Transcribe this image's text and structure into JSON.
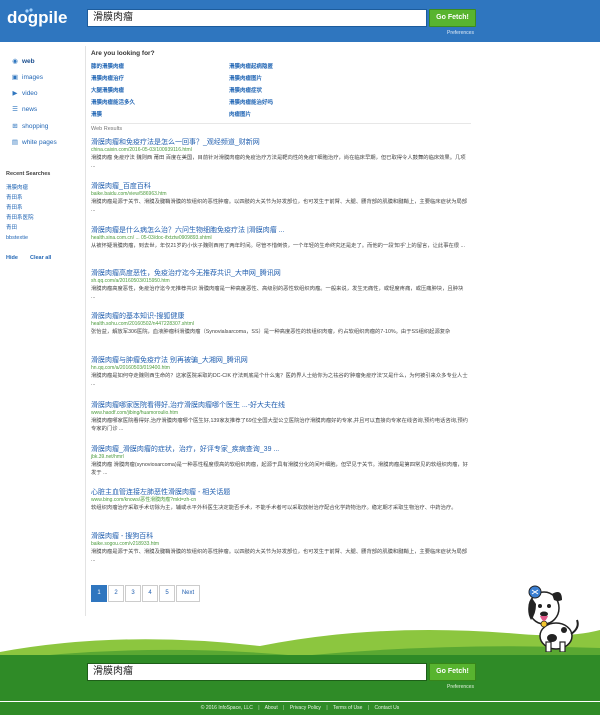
{
  "header": {
    "logo_text": "dogpile",
    "query": "滑膜肉瘤",
    "fetch_label": "Go Fetch!",
    "preferences_label": "Preferences"
  },
  "sidebar": {
    "nav": [
      {
        "label": "web",
        "icon": "globe-icon"
      },
      {
        "label": "images",
        "icon": "camera-icon"
      },
      {
        "label": "video",
        "icon": "play-icon"
      },
      {
        "label": "news",
        "icon": "rss-icon"
      },
      {
        "label": "shopping",
        "icon": "cart-icon"
      },
      {
        "label": "white pages",
        "icon": "phone-book-icon"
      }
    ],
    "recent_title": "Recent Searches",
    "recent": [
      "滑膜肉瘤",
      "青田系",
      "青田系",
      "青田系医院",
      "青田",
      "bbstextie"
    ],
    "hide_label": "Hide",
    "clear_label": "Clear all"
  },
  "suggestions": {
    "title": "Are you looking for?",
    "left": [
      "膝的滑膜肉瘤",
      "滑膜肉瘤治疗",
      "大腿滑膜肉瘤",
      "滑膜肉瘤能活多久",
      "滑膜"
    ],
    "right": [
      "滑膜肉瘤起病隐匿",
      "滑膜肉瘤图片",
      "滑膜肉瘤症状",
      "滑膜肉瘤能治好吗",
      "肉瘤图片"
    ]
  },
  "web_results_label": "Web Results",
  "results": [
    {
      "title": "滑膜肉瘤和免疫疗法是怎么一回事？_观经频道_财新网",
      "url": "china.caixin.com/2016-05-03/100939116.html",
      "desc": "滑膜肉瘤 免疫疗法 魏则西 莆田 百度在美国，目前针对滑膜肉瘤的免疫治疗方法是靶向性的免疫T细胞治疗，尚在临床早期，但已取得令人鼓舞的临床效果。几项 ..."
    },
    {
      "title": "滑膜肉瘤_百度百科",
      "url": "baike.baidu.com/view/586963.htm",
      "desc": "滑膜肉瘤是源于关节、滑膜及腱鞘滑膜的软组织的恶性肿瘤。以四肢的大关节为好发部位，也可发生于前臂、大腿、腰背部的肌膜和腱鞘上，主要临床症状为局部 ..."
    },
    {
      "title": "滑膜肉瘤是什么病怎么治？六问生物细胞免疫疗法 |滑膜肉瘤 ...",
      "url": "health.sina.com.cn/ ... 05-03/doc-ifxtztw0909893.shtml",
      "desc": "从被怀疑滑膜肉瘤，到去世，年仅21岁的小伙子魏则西用了两年时间。尽管不惜倒债，一个年轻的生命终究还是走了。而他的一段'知乎'上的留言，让此事在很 ..."
    },
    {
      "title": "滑膜肉瘤高度恶性，免疫治疗迄今无推荐共识_大申网_腾讯网",
      "url": "sh.qq.com/a/20160503/015950.htm",
      "desc": "滑膜肉瘤高度恶性，免疫治疗迄今无推荐共识 滑膜肉瘤是一种高度恶性、高级别的恶性软组织肉瘤。一般来说，发生无痛性，或轻度疼痛，或压痛肿块，且肿块 ..."
    },
    {
      "title": "滑膜肉瘤的基本知识-搜狐健康",
      "url": "health.sohu.com/20160502/n447228307.shtml",
      "desc": "张怡益，解放军306医院，血液肿瘤科滑膜肉瘤（Synovialsarcoma，SS）是一种高度恶性的软组织肉瘤，约占软组织肉瘤的7-10%。由于SS组织起源复杂"
    },
    {
      "title": "滑膜肉瘤与肿瘤免疫疗法 别再被骗_大湘网_腾讯网",
      "url": "hn.qq.com/a/20160503/019400.htm",
      "desc": "滑膜肉瘤是如何夺走魏则西生命的？这家医院采取的DC-CIK 疗法到底是个什么鬼？医药界人士给你为之祛谷的'肿瘤免疫疗法'又是什么，为何被引来众多专业人士 ..."
    },
    {
      "title": "滑膜肉瘤哪家医院看得好,治疗滑膜肉瘤哪个医生 ...-好大夫在线",
      "url": "www.haodf.com/jibing/huamoroulio.htm",
      "desc": "滑膜肉瘤哪家医院看得好,治疗滑膜肉瘤哪个医生好,139家友推荐了69位全国大型公立医院治疗滑膜肉瘤好的专家,并且可以直接向专家在线咨询,预约电话咨询,预约专家的门诊 ..."
    },
    {
      "title": "滑膜肉瘤_滑膜肉瘤的症状，治疗，好评专家_疾病查询_39 ...",
      "url": "jbk.39.net/hmrl",
      "desc": "滑膜肉瘤 滑膜肉瘤(synoviosarcoma)是一种恶性程度很高的软组织肉瘤，起源于具有滑膜分化的间叶细胞，但罕见于关节。滑膜肉瘤是第四常见的软组织肉瘤，好发于 ..."
    },
    {
      "title": "心脏主血管连接左肺恶性滑膜肉瘤 - 相关话题",
      "url": "www.bing.com/knows/恶性滑膜肉瘤?mkt=zh-cn",
      "desc": "软组织肉瘤治疗采取手术切除为主，辅或水平外科医生决定能否手术，不能手术者可以采取放射治疗配合化学药物治疗。稳定期才采取生物治疗、中药治疗。"
    },
    {
      "title": "滑膜肉瘤 - 搜狗百科",
      "url": "baike.sogou.com/v218933.htm",
      "desc": "滑膜肉瘤是源于关节、滑膜及腱鞘滑膜的软组织的恶性肿瘤。以四肢的大关节为好发部位，也可发生于前臂、大腿、腰背部的肌膜和腱鞘上，主要临床症状为局部 ..."
    }
  ],
  "pagination": {
    "pages": [
      "1",
      "2",
      "3",
      "4",
      "5"
    ],
    "next_label": "Next"
  },
  "footer": {
    "query": "滑膜肉瘤",
    "fetch_label": "Go Fetch!",
    "preferences_label": "Preferences",
    "copyright": "© 2016 InfoSpace, LLC",
    "links": [
      "About",
      "Privacy Policy",
      "Terms of Use",
      "Contact Us"
    ]
  },
  "colors": {
    "header_blue": "#2f76bf",
    "footer_green": "#2f8b27",
    "button_green": "#58b42f",
    "link_blue": "#2360b0",
    "url_green": "#4d9b3e"
  }
}
